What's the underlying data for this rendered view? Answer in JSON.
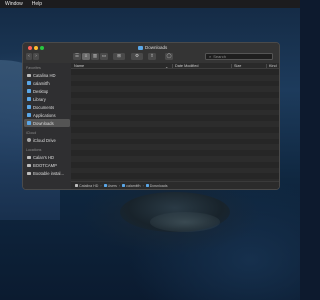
{
  "menubar": {
    "items": [
      "Window",
      "Help"
    ]
  },
  "window": {
    "title": "Downloads",
    "toolbar": {
      "back": "‹",
      "forward": "›",
      "view_icon": "☰",
      "view_list": "≡",
      "view_columns": "▥",
      "view_gallery": "▭",
      "group": "⊞",
      "action": "⚙",
      "share": "⇧",
      "tag": "◯",
      "search_placeholder": "Search",
      "search_icon": "⌕"
    },
    "sidebar": {
      "sections": [
        {
          "title": "Favorites",
          "items": [
            {
              "label": "Catalina HD",
              "icon": "drive-icon"
            },
            {
              "label": "calamitfh",
              "icon": "home-icon"
            },
            {
              "label": "Desktop",
              "icon": "folder-icon"
            },
            {
              "label": "Library",
              "icon": "folder-icon"
            },
            {
              "label": "Documents",
              "icon": "folder-icon"
            },
            {
              "label": "Applications",
              "icon": "apps-icon"
            },
            {
              "label": "Downloads",
              "icon": "download-icon",
              "selected": true
            }
          ]
        },
        {
          "title": "iCloud",
          "items": [
            {
              "label": "iCloud Drive",
              "icon": "cloud-icon"
            }
          ]
        },
        {
          "title": "Locations",
          "items": [
            {
              "label": "Calan's HD",
              "icon": "drive-icon"
            },
            {
              "label": "BOOTCAMP",
              "icon": "drive-icon"
            },
            {
              "label": "Bootable instal...",
              "icon": "drive-icon"
            }
          ]
        }
      ]
    },
    "columns": [
      "Name",
      "Date Modified",
      "Size",
      "Kind"
    ],
    "sort_indicator": "⌄",
    "rows_count_visible": 21,
    "pathbar": [
      "Catalina HD",
      "Users",
      "calamitfh",
      "Downloads"
    ],
    "pathbar_separator": "›"
  },
  "colors": {
    "accent_folder": "#5aa7e8",
    "close": "#ff5f57",
    "minimize": "#febc2e",
    "zoom": "#28c840"
  }
}
